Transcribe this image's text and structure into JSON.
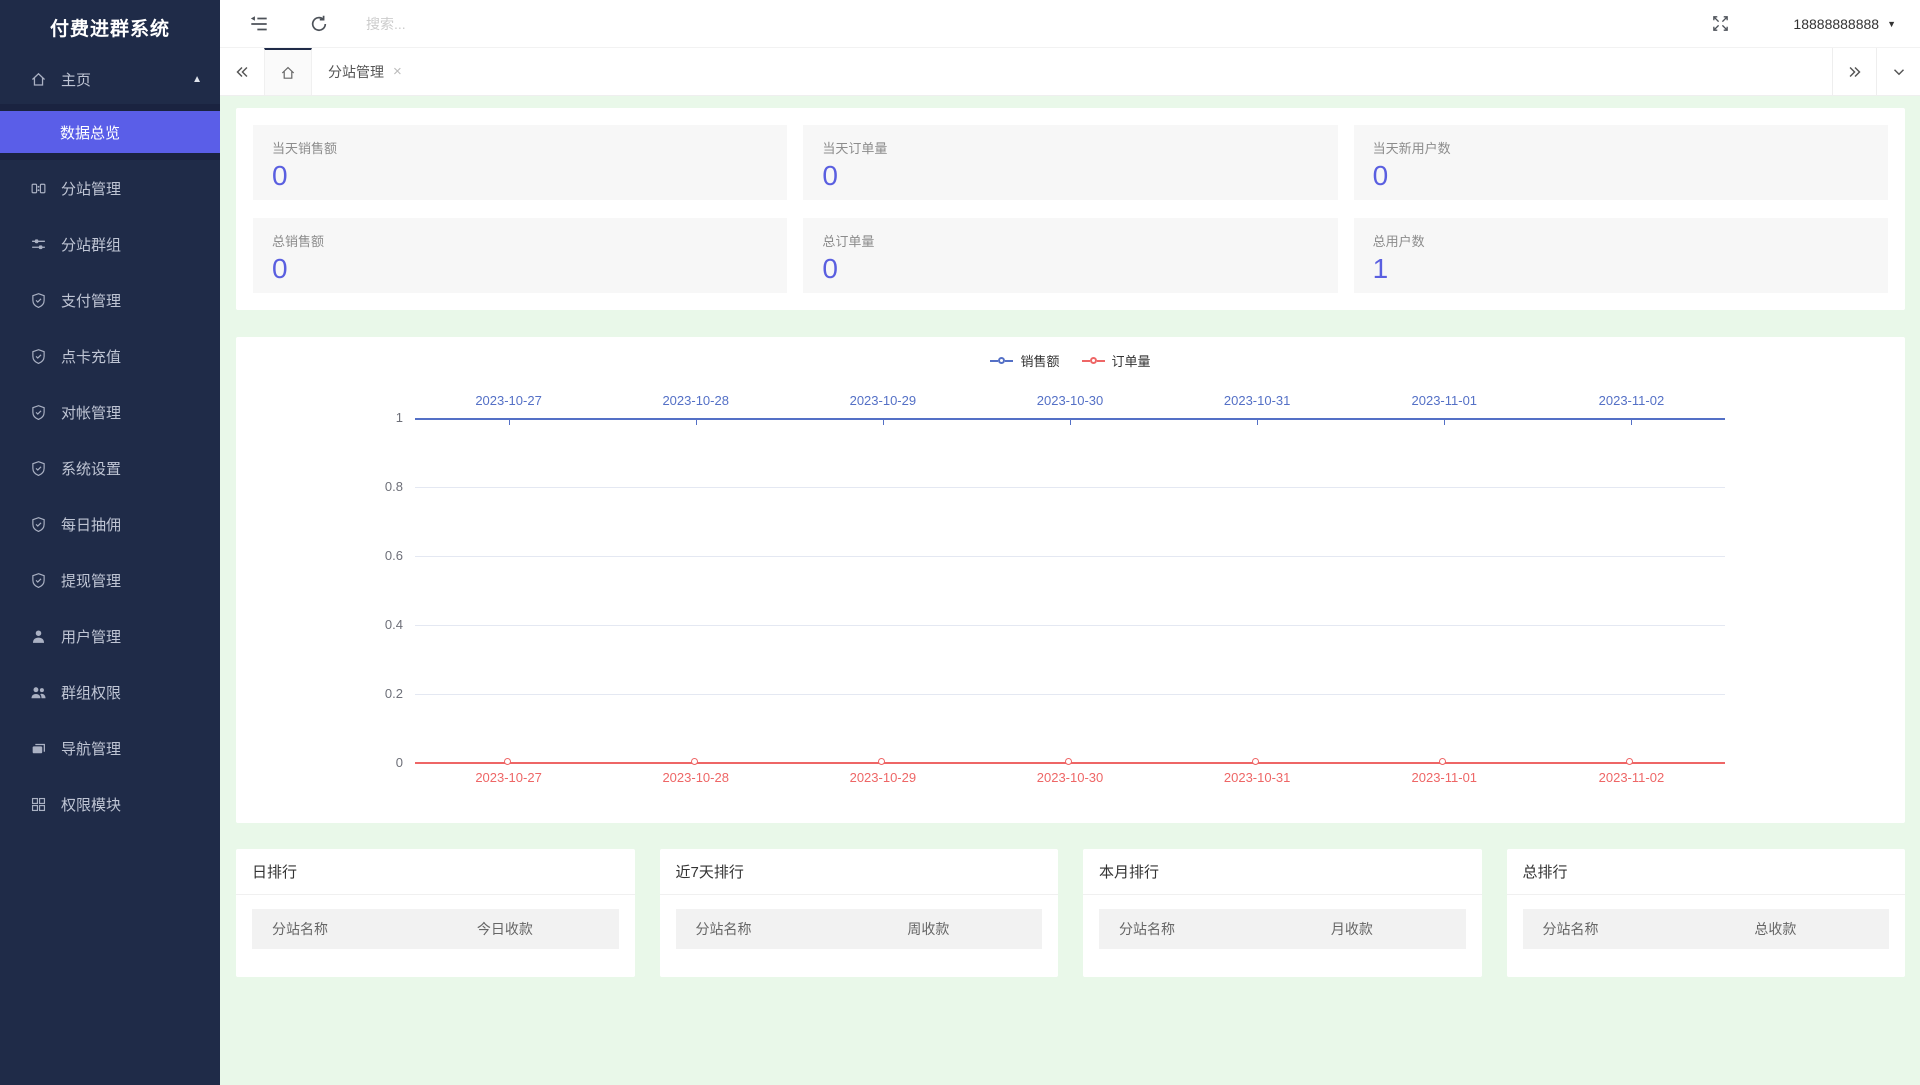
{
  "app": {
    "title": "付费进群系统"
  },
  "topbar": {
    "search_placeholder": "搜索...",
    "username": "18888888888"
  },
  "tab_bar": {
    "active_tab": {
      "label": "分站管理",
      "close": "×"
    }
  },
  "sidebar": {
    "home": {
      "label": "主页"
    },
    "active_item": {
      "label": "数据总览"
    },
    "items": [
      {
        "label": "分站管理"
      },
      {
        "label": "分站群组"
      },
      {
        "label": "支付管理"
      },
      {
        "label": "点卡充值"
      },
      {
        "label": "对帐管理"
      },
      {
        "label": "系统设置"
      },
      {
        "label": "每日抽佣"
      },
      {
        "label": "提现管理"
      },
      {
        "label": "用户管理"
      },
      {
        "label": "群组权限"
      },
      {
        "label": "导航管理"
      },
      {
        "label": "权限模块"
      }
    ]
  },
  "stats": {
    "cards": [
      {
        "label": "当天销售额",
        "value": "0"
      },
      {
        "label": "当天订单量",
        "value": "0"
      },
      {
        "label": "当天新用户数",
        "value": "0"
      },
      {
        "label": "总销售额",
        "value": "0"
      },
      {
        "label": "总订单量",
        "value": "0"
      },
      {
        "label": "总用户数",
        "value": "1"
      }
    ]
  },
  "chart_data": {
    "type": "line",
    "title": "",
    "categories": [
      "2023-10-27",
      "2023-10-28",
      "2023-10-29",
      "2023-10-30",
      "2023-10-31",
      "2023-11-01",
      "2023-11-02"
    ],
    "series": [
      {
        "name": "销售额",
        "color": "#5470c6",
        "values": [
          0,
          0,
          0,
          0,
          0,
          0,
          0
        ],
        "axis": "top"
      },
      {
        "name": "订单量",
        "color": "#ee6666",
        "values": [
          0,
          0,
          0,
          0,
          0,
          0,
          0
        ],
        "axis": "bottom"
      }
    ],
    "ylim": [
      0,
      1
    ],
    "yticks": [
      0,
      0.2,
      0.4,
      0.6,
      0.8,
      1
    ],
    "grid": true,
    "legend_position": "top-center",
    "grid_color": "#e4e8f2"
  },
  "rankings": [
    {
      "title": "日排行",
      "columns": [
        "分站名称",
        "今日收款"
      ],
      "rows": []
    },
    {
      "title": "近7天排行",
      "columns": [
        "分站名称",
        "周收款"
      ],
      "rows": []
    },
    {
      "title": "本月排行",
      "columns": [
        "分站名称",
        "月收款"
      ],
      "rows": []
    },
    {
      "title": "总排行",
      "columns": [
        "分站名称",
        "总收款"
      ],
      "rows": []
    }
  ],
  "colors": {
    "sidebar_bg": "#1f2b48",
    "submenu_bg": "#1a2340",
    "accent": "#5a5ee8",
    "stat_value": "#5a5fe0",
    "series_blue": "#5470c6",
    "series_red": "#ee6666",
    "content_bg": "#e9f8e9"
  }
}
